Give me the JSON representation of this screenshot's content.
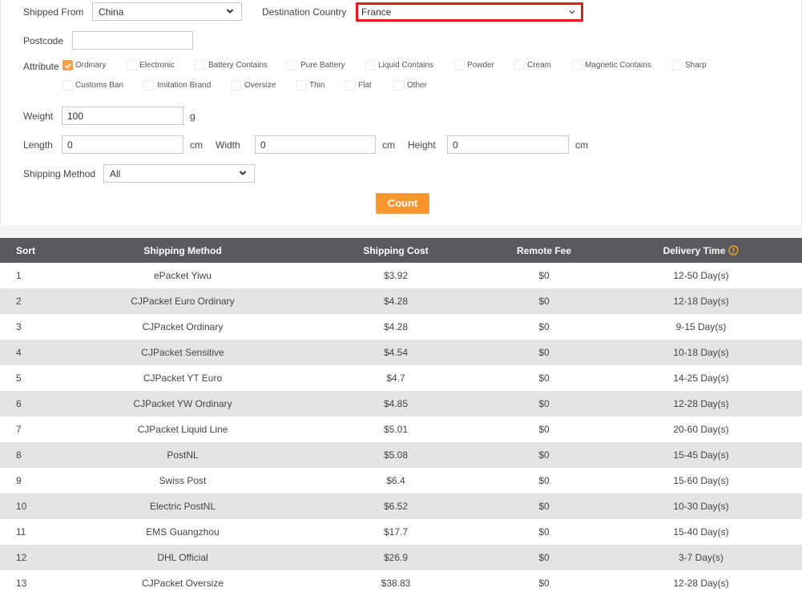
{
  "form": {
    "shipped_from": {
      "label": "Shipped From",
      "value": "China"
    },
    "destination": {
      "label": "Destination Country",
      "value": "France"
    },
    "postcode": {
      "label": "Postcode",
      "value": ""
    },
    "attribute": {
      "label": "Attribute",
      "options": [
        {
          "label": "Ordinary",
          "checked": true
        },
        {
          "label": "Electronic",
          "checked": false
        },
        {
          "label": "Battery Contains",
          "checked": false
        },
        {
          "label": "Pure Battery",
          "checked": false
        },
        {
          "label": "Liquid Contains",
          "checked": false
        },
        {
          "label": "Powder",
          "checked": false
        },
        {
          "label": "Cream",
          "checked": false
        },
        {
          "label": "Magnetic Contains",
          "checked": false
        },
        {
          "label": "Sharp",
          "checked": false
        },
        {
          "label": "Customs Ban",
          "checked": false
        },
        {
          "label": "Imitation Brand",
          "checked": false
        },
        {
          "label": "Oversize",
          "checked": false
        },
        {
          "label": "Thin",
          "checked": false
        },
        {
          "label": "Flat",
          "checked": false
        },
        {
          "label": "Other",
          "checked": false
        }
      ]
    },
    "weight": {
      "label": "Weight",
      "value": "100",
      "unit": "g"
    },
    "length": {
      "label": "Length",
      "value": "0",
      "unit": "cm"
    },
    "width": {
      "label": "Width",
      "value": "0",
      "unit": "cm"
    },
    "height": {
      "label": "Height",
      "value": "0",
      "unit": "cm"
    },
    "shipping_method": {
      "label": "Shipping Method",
      "value": "All"
    },
    "count_button": "Count"
  },
  "colors": {
    "accent": "#f8962d",
    "highlight_border": "#e01e1e",
    "table_header": "#5a5a5e",
    "row_alt": "#e4e4e4"
  },
  "table": {
    "headers": [
      "Sort",
      "Shipping Method",
      "Shipping Cost",
      "Remote Fee",
      "Delivery Time"
    ],
    "rows": [
      {
        "sort": "1",
        "method": "ePacket Yiwu",
        "cost": "$3.92",
        "fee": "$0",
        "time": "12-50 Day(s)"
      },
      {
        "sort": "2",
        "method": "CJPacket Euro Ordinary",
        "cost": "$4.28",
        "fee": "$0",
        "time": "12-18 Day(s)"
      },
      {
        "sort": "3",
        "method": "CJPacket Ordinary",
        "cost": "$4.28",
        "fee": "$0",
        "time": "9-15 Day(s)"
      },
      {
        "sort": "4",
        "method": "CJPacket Sensitive",
        "cost": "$4.54",
        "fee": "$0",
        "time": "10-18 Day(s)"
      },
      {
        "sort": "5",
        "method": "CJPacket YT Euro",
        "cost": "$4.7",
        "fee": "$0",
        "time": "14-25 Day(s)"
      },
      {
        "sort": "6",
        "method": "CJPacket YW Ordinary",
        "cost": "$4.85",
        "fee": "$0",
        "time": "12-28 Day(s)"
      },
      {
        "sort": "7",
        "method": "CJPacket Liquid Line",
        "cost": "$5.01",
        "fee": "$0",
        "time": "20-60 Day(s)"
      },
      {
        "sort": "8",
        "method": "PostNL",
        "cost": "$5.08",
        "fee": "$0",
        "time": "15-45 Day(s)"
      },
      {
        "sort": "9",
        "method": "Swiss Post",
        "cost": "$6.4",
        "fee": "$0",
        "time": "15-60 Day(s)"
      },
      {
        "sort": "10",
        "method": "Electric PostNL",
        "cost": "$6.52",
        "fee": "$0",
        "time": "10-30 Day(s)"
      },
      {
        "sort": "11",
        "method": "EMS Guangzhou",
        "cost": "$17.7",
        "fee": "$0",
        "time": "15-40 Day(s)"
      },
      {
        "sort": "12",
        "method": "DHL Official",
        "cost": "$26.9",
        "fee": "$0",
        "time": "3-7 Day(s)"
      },
      {
        "sort": "13",
        "method": "CJPacket Oversize",
        "cost": "$38.83",
        "fee": "$0",
        "time": "12-28 Day(s)"
      }
    ]
  }
}
